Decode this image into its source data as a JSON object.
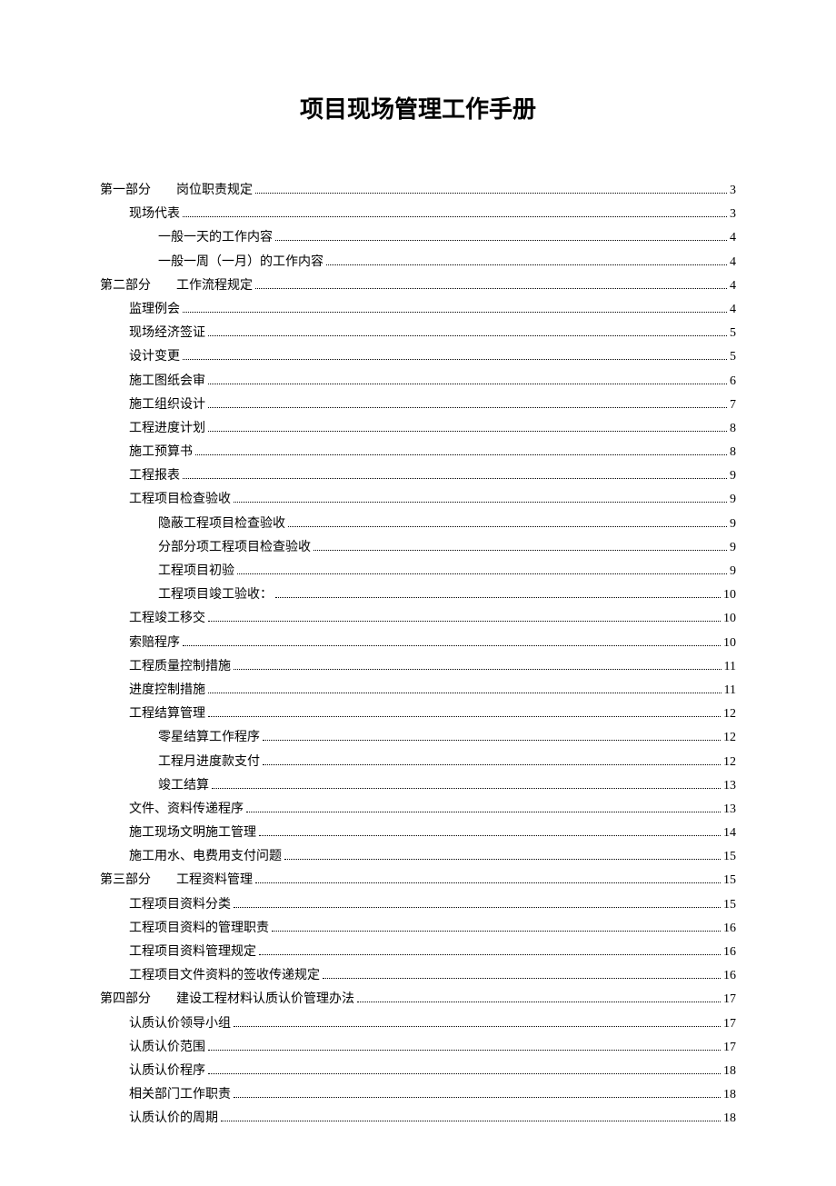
{
  "title": "项目现场管理工作手册",
  "toc": [
    {
      "indent": 0,
      "label": "第一部分　　岗位职责规定",
      "page": "3"
    },
    {
      "indent": 1,
      "label": "现场代表",
      "page": "3"
    },
    {
      "indent": 2,
      "label": "一般一天的工作内容",
      "page": "4"
    },
    {
      "indent": 2,
      "label": "一般一周（一月）的工作内容",
      "page": "4"
    },
    {
      "indent": 0,
      "label": "第二部分　　工作流程规定",
      "page": "4"
    },
    {
      "indent": 1,
      "label": "监理例会",
      "page": "4"
    },
    {
      "indent": 1,
      "label": "现场经济签证",
      "page": "5"
    },
    {
      "indent": 1,
      "label": "设计变更",
      "page": "5"
    },
    {
      "indent": 1,
      "label": "施工图纸会审",
      "page": "6"
    },
    {
      "indent": 1,
      "label": "施工组织设计",
      "page": "7"
    },
    {
      "indent": 1,
      "label": "工程进度计划",
      "page": "8"
    },
    {
      "indent": 1,
      "label": "施工预算书",
      "page": "8"
    },
    {
      "indent": 1,
      "label": "工程报表",
      "page": "9"
    },
    {
      "indent": 1,
      "label": "工程项目检查验收",
      "page": "9"
    },
    {
      "indent": 2,
      "label": "隐蔽工程项目检查验收",
      "page": "9"
    },
    {
      "indent": 2,
      "label": "分部分项工程项目检查验收",
      "page": "9"
    },
    {
      "indent": 2,
      "label": "工程项目初验",
      "page": "9"
    },
    {
      "indent": 2,
      "label": "工程项目竣工验收：",
      "page": "10"
    },
    {
      "indent": 1,
      "label": "工程竣工移交",
      "page": "10"
    },
    {
      "indent": 1,
      "label": "索赔程序",
      "page": "10"
    },
    {
      "indent": 1,
      "label": "工程质量控制措施",
      "page": "11"
    },
    {
      "indent": 1,
      "label": "进度控制措施",
      "page": "11"
    },
    {
      "indent": 1,
      "label": "工程结算管理",
      "page": "12"
    },
    {
      "indent": 2,
      "label": "零星结算工作程序",
      "page": "12"
    },
    {
      "indent": 2,
      "label": "工程月进度款支付",
      "page": "12"
    },
    {
      "indent": 2,
      "label": "竣工结算",
      "page": "13"
    },
    {
      "indent": 1,
      "label": "文件、资料传递程序",
      "page": "13"
    },
    {
      "indent": 1,
      "label": "施工现场文明施工管理",
      "page": "14"
    },
    {
      "indent": 1,
      "label": "施工用水、电费用支付问题",
      "page": "15"
    },
    {
      "indent": 0,
      "label": "第三部分　　工程资料管理",
      "page": "15"
    },
    {
      "indent": 1,
      "label": "工程项目资料分类",
      "page": "15"
    },
    {
      "indent": 1,
      "label": "工程项目资料的管理职责",
      "page": "16"
    },
    {
      "indent": 1,
      "label": "工程项目资料管理规定",
      "page": "16"
    },
    {
      "indent": 1,
      "label": "工程项目文件资料的签收传递规定",
      "page": "16"
    },
    {
      "indent": 0,
      "label": "第四部分　　建设工程材料认质认价管理办法",
      "page": "17"
    },
    {
      "indent": 1,
      "label": "认质认价领导小组",
      "page": "17"
    },
    {
      "indent": 1,
      "label": "认质认价范围",
      "page": "17"
    },
    {
      "indent": 1,
      "label": "认质认价程序",
      "page": "18"
    },
    {
      "indent": 1,
      "label": "相关部门工作职责",
      "page": "18"
    },
    {
      "indent": 1,
      "label": "认质认价的周期",
      "page": "18"
    }
  ]
}
